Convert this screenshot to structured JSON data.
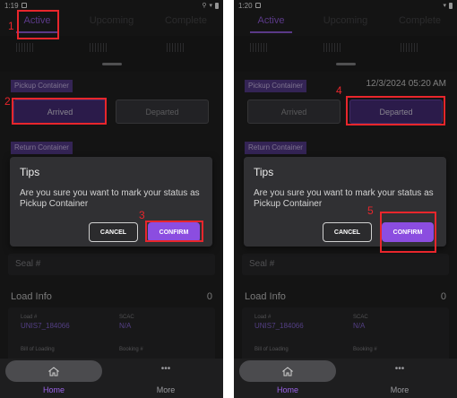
{
  "left": {
    "status_bar": {
      "time": "1:19"
    },
    "tabs": [
      "Active",
      "Upcoming",
      "Complete"
    ],
    "pickup_tag": "Pickup Container",
    "pickup_datetime": "",
    "status_buttons": [
      "Arrived",
      "Departed"
    ],
    "return_tag": "Return Container",
    "seal_label": "Seal #",
    "load_info": {
      "title": "Load Info",
      "count": "0"
    },
    "fields": {
      "load_label": "Load #",
      "load_value": "UNIS7_184066",
      "scac_label": "SCAC",
      "scac_value": "N/A",
      "bol_label": "Bill of Loading",
      "booking_label": "Booking #"
    },
    "dialog": {
      "title": "Tips",
      "message": "Are you sure  you want to mark your status as Pickup Container",
      "cancel": "CANCEL",
      "confirm": "CONFIRM"
    },
    "nav": [
      "Home",
      "More"
    ],
    "steps": [
      "1",
      "2",
      "3"
    ]
  },
  "right": {
    "status_bar": {
      "time": "1:20"
    },
    "tabs": [
      "Active",
      "Upcoming",
      "Complete"
    ],
    "pickup_tag": "Pickup Container",
    "pickup_datetime": "12/3/2024 05:20 AM",
    "status_buttons": [
      "Arrived",
      "Departed"
    ],
    "return_tag": "Return Container",
    "seal_label": "Seal #",
    "load_info": {
      "title": "Load Info",
      "count": "0"
    },
    "fields": {
      "load_label": "Load #",
      "load_value": "UNIS7_184066",
      "scac_label": "SCAC",
      "scac_value": "N/A",
      "bol_label": "Bill of Loading",
      "booking_label": "Booking #"
    },
    "dialog": {
      "title": "Tips",
      "message": "Are you sure  you want to mark your status as Pickup Container",
      "cancel": "CANCEL",
      "confirm": "CONFIRM"
    },
    "nav": [
      "Home",
      "More"
    ],
    "steps": [
      "4",
      "5"
    ]
  },
  "colors": {
    "accent": "#9c63e8",
    "confirm_button": "#8b4de0",
    "annotation": "#e8262c",
    "background": "#232324"
  },
  "icons": {
    "home": "home-icon",
    "more": "more-dots-icon"
  }
}
